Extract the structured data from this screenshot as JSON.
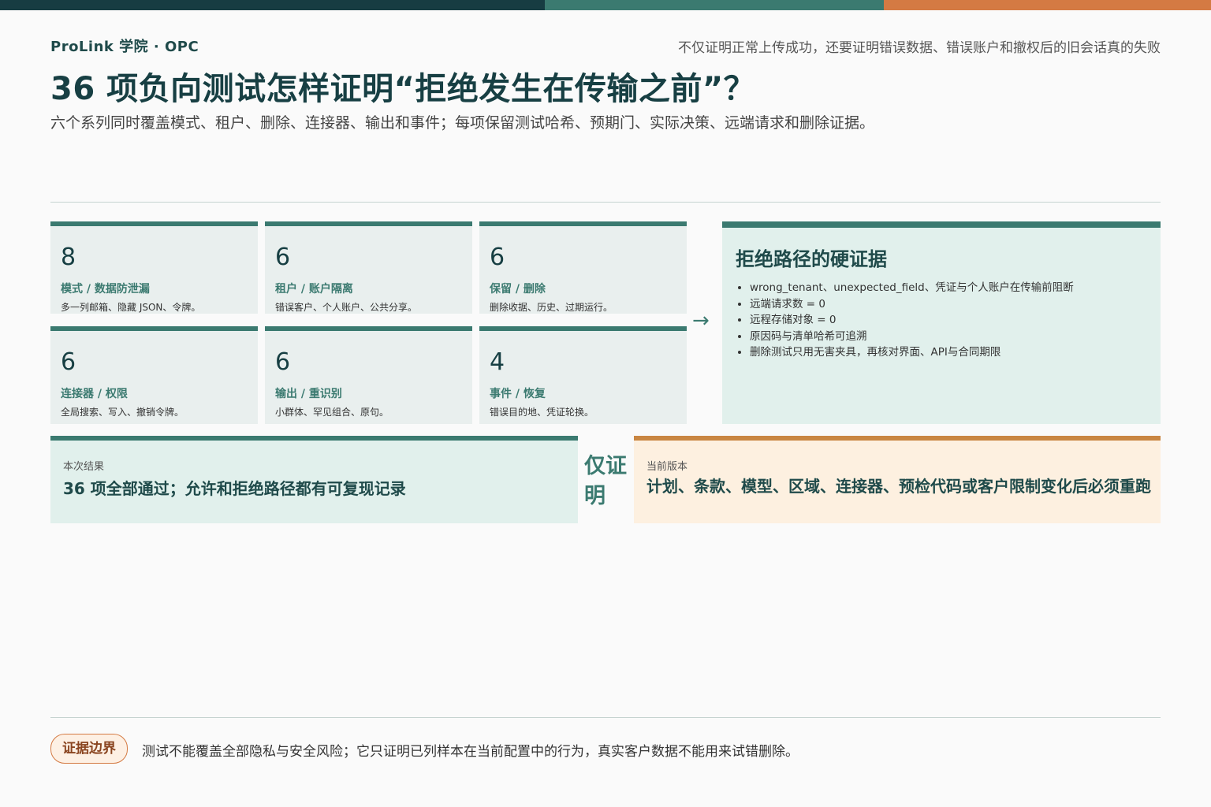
{
  "header": {
    "brand": "ProLink 学院 · OPC",
    "tagline": "不仅证明正常上传成功，还要证明错误数据、错误账户和撤权后的旧会话真的失败",
    "title": "36 项负向测试怎样证明“拒绝发生在传输之前”？",
    "subtitle": "六个系列同时覆盖模式、租户、删除、连接器、输出和事件；每项保留测试哈希、预期门、实际决策、远端请求和删除证据。"
  },
  "cards": [
    {
      "count": "8",
      "label": "模式 / 数据防泄漏",
      "desc": "多一列邮箱、隐藏 JSON、令牌。"
    },
    {
      "count": "6",
      "label": "租户 / 账户隔离",
      "desc": "错误客户、个人账户、公共分享。"
    },
    {
      "count": "6",
      "label": "保留 / 删除",
      "desc": "删除收据、历史、过期运行。"
    },
    {
      "count": "6",
      "label": "连接器 / 权限",
      "desc": "全局搜索、写入、撤销令牌。"
    },
    {
      "count": "6",
      "label": "输出 / 重识别",
      "desc": "小群体、罕见组合、原句。"
    },
    {
      "count": "4",
      "label": "事件 / 恢复",
      "desc": "错误目的地、凭证轮换。"
    }
  ],
  "arrow": "→",
  "evidence": {
    "title": "拒绝路径的硬证据",
    "items": [
      "wrong_tenant、unexpected_field、凭证与个人账户在传输前阻断",
      "远端请求数 = 0",
      "远程存储对象 = 0",
      "原因码与清单哈希可追溯",
      "删除测试只用无害夹具，再核对界面、API与合同期限"
    ]
  },
  "result": {
    "caption": "本次结果",
    "text": "36 项全部通过；允许和拒绝路径都有可复现记录"
  },
  "connector_label": "仅证明",
  "version": {
    "caption": "当前版本",
    "text": "计划、条款、模型、区域、连接器、预检代码或客户限制变化后必须重跑"
  },
  "footer": {
    "badge": "证据边界",
    "text": "测试不能覆盖全部隐私与安全风险；它只证明已列样本在当前配置中的行为，真实客户数据不能用来试错删除。"
  },
  "colors": {
    "dark_teal": "#173f43",
    "teal": "#3b7a70",
    "orange": "#d47a43",
    "card_bg": "#e9efee",
    "evidence_bg": "#e1f0ec",
    "version_bg": "#fdf0e0"
  }
}
